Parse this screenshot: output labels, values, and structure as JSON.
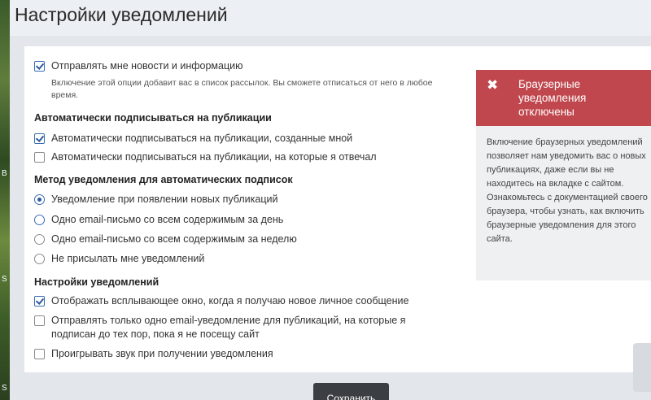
{
  "header": {
    "title": "Настройки уведомлений"
  },
  "left_strip": {
    "fragments": [
      "B",
      "S",
      "S"
    ]
  },
  "newsletter": {
    "label": "Отправлять мне новости и информацию",
    "checked": true,
    "hint": "Включение этой опции добавит вас в список рассылок. Вы сможете отписаться от него в любое время."
  },
  "auto_subscribe": {
    "title": "Автоматически подписываться на публикации",
    "options": [
      {
        "label": "Автоматически подписываться на публикации, созданные мной",
        "checked": true
      },
      {
        "label": "Автоматически подписываться на публикации, на которые я отвечал",
        "checked": false
      }
    ]
  },
  "method": {
    "title": "Метод уведомления для автоматических подписок",
    "options": [
      {
        "label": "Уведомление при появлении новых публикаций",
        "selected": true
      },
      {
        "label": "Одно email-письмо со всем содержимым за день",
        "selected": false
      },
      {
        "label": "Одно email-письмо со всем содержимым за неделю",
        "selected": false
      },
      {
        "label": "Не присылать мне уведомлений",
        "selected": false
      }
    ]
  },
  "settings": {
    "title": "Настройки уведомлений",
    "options": [
      {
        "label": "Отображать всплывающее окно, когда я получаю новое личное сообщение",
        "checked": true
      },
      {
        "label": "Отправлять только одно email-уведомление для публикаций, на которые я подписан до тех пор, пока я не посещу сайт",
        "checked": false
      },
      {
        "label": "Проигрывать звук при получении уведомления",
        "checked": false
      }
    ]
  },
  "alert": {
    "icon": "close-icon",
    "title": "Браузерные уведомления отключены",
    "body": "Включение браузерных уведомлений позволяет нам уведомить вас о новых публикациях, даже если вы не находитесь на вкладке с сайтом. Ознакомьтесь с документацией своего браузера, чтобы узнать, как включить браузерные уведомления для этого сайта.",
    "color": "#c0474d"
  },
  "save_button": {
    "label": "Сохранить"
  },
  "colors": {
    "accent": "#2c5a9e",
    "button": "#3b3f44"
  }
}
